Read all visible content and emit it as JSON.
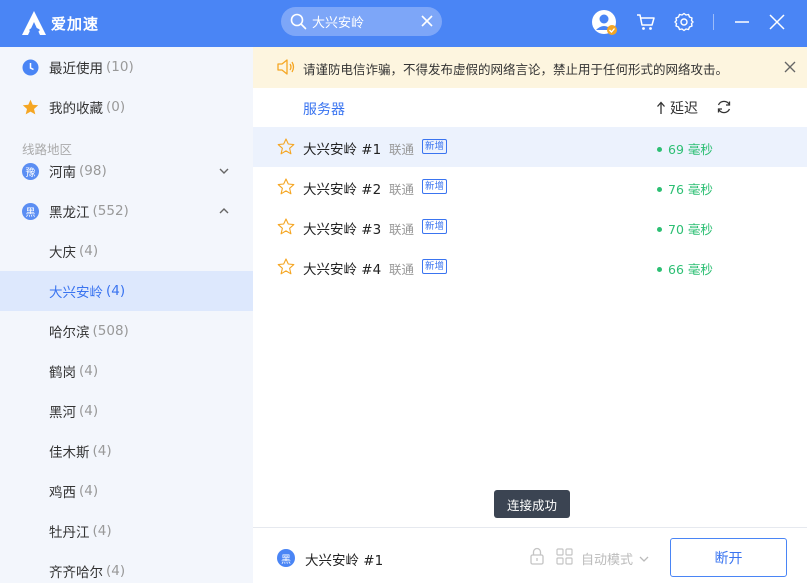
{
  "app": {
    "name": "爱加速"
  },
  "search": {
    "value": "大兴安岭"
  },
  "sidebar": {
    "recent": {
      "label": "最近使用",
      "count": "(10)"
    },
    "favorites": {
      "label": "我的收藏",
      "count": "(0)"
    },
    "section_title": "线路地区",
    "provinces": [
      {
        "badge": "豫",
        "label": "河南",
        "count": "(98)"
      },
      {
        "badge": "黑",
        "label": "黑龙江",
        "count": "(552)"
      }
    ],
    "cities": [
      {
        "label": "大庆",
        "count": "(4)"
      },
      {
        "label": "大兴安岭",
        "count": "(4)"
      },
      {
        "label": "哈尔滨",
        "count": "(508)"
      },
      {
        "label": "鹤岗",
        "count": "(4)"
      },
      {
        "label": "黑河",
        "count": "(4)"
      },
      {
        "label": "佳木斯",
        "count": "(4)"
      },
      {
        "label": "鸡西",
        "count": "(4)"
      },
      {
        "label": "牡丹江",
        "count": "(4)"
      },
      {
        "label": "齐齐哈尔",
        "count": "(4)"
      }
    ]
  },
  "notice": {
    "text": "请谨防电信诈骗，不得发布虚假的网络言论，禁止用于任何形式的网络攻击。"
  },
  "list": {
    "col_server": "服务器",
    "col_latency": "延迟",
    "rows": [
      {
        "name": "大兴安岭 #1",
        "isp": "联通",
        "badge": "新增",
        "ping": "69 毫秒"
      },
      {
        "name": "大兴安岭 #2",
        "isp": "联通",
        "badge": "新增",
        "ping": "76 毫秒"
      },
      {
        "name": "大兴安岭 #3",
        "isp": "联通",
        "badge": "新增",
        "ping": "70 毫秒"
      },
      {
        "name": "大兴安岭 #4",
        "isp": "联通",
        "badge": "新增",
        "ping": "66 毫秒"
      }
    ]
  },
  "toast": {
    "text": "连接成功"
  },
  "footer": {
    "current_badge": "黑",
    "current_name": "大兴安岭 #1",
    "mode_label": "自动模式",
    "disconnect_label": "断开"
  },
  "colors": {
    "brand": "#4a85f5",
    "accent_text": "#3a74f0",
    "ping": "#2cbf73",
    "notice_bg": "#fdf5df"
  }
}
